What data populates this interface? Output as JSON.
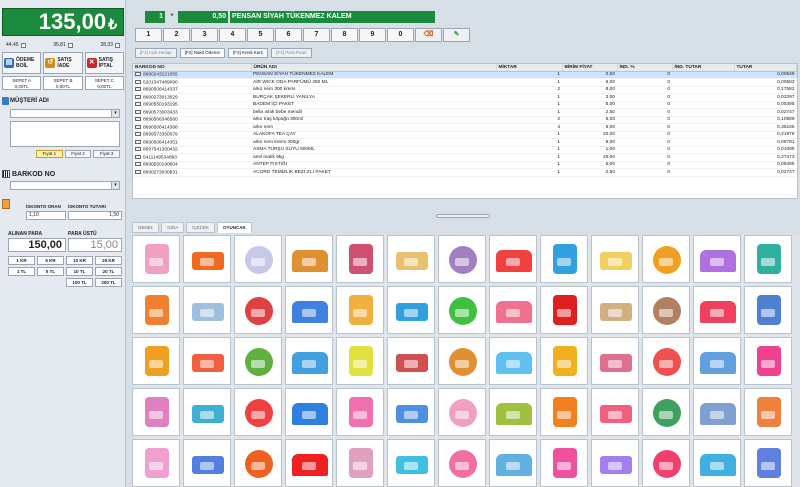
{
  "left_panel": {
    "total_amount": "135,00",
    "currency": "₺",
    "subtotals": [
      "44,45",
      "35,81",
      "28,33"
    ],
    "action_buttons": [
      {
        "label": "ÖDEME BOİL",
        "icon": "payment-icon",
        "color": "#2f6fbf"
      },
      {
        "label": "SATIŞ İADE",
        "icon": "return-icon",
        "color": "#d38b1a"
      },
      {
        "label": "SATIŞ İPTAL",
        "icon": "cancel-icon",
        "color": "#c82828"
      }
    ],
    "sepetler": [
      {
        "name": "SEPET A",
        "value": "0,00TL"
      },
      {
        "name": "SEPET B",
        "value": "0,00TL"
      },
      {
        "name": "SEPET C",
        "value": "0,00TL"
      }
    ],
    "musteri_label": "MÜŞTERİ ADI",
    "fiyatlar": [
      "Fiyat 1",
      "Fiyat 2",
      "Fiyat 3"
    ],
    "selected_fiyat": "Fiyat 1",
    "barkod_label": "BARKOD NO",
    "iskonto_oran_label": "İSKONTO ORAN",
    "iskonto_tutar_label": "İSKONTO TUTARI",
    "iskonto_oran": "1,10",
    "iskonto_tutar": "1,50",
    "alinan_label": "ALINAN PARA",
    "paraustu_label": "PARA ÜSTÜ",
    "alinan_para": "150,00",
    "para_ustu": "15,00",
    "para_buttons": [
      "1 KR",
      "5 KR",
      "10 KR",
      "25 KR",
      "1 TL",
      "5 TL",
      "10 TL",
      "20 TL",
      "",
      "",
      "100 TL",
      "200 TL"
    ]
  },
  "entry": {
    "quantity": "1",
    "multiplier": "*",
    "price": "0,50",
    "product_name": "PENSAN SİYAH TÜKENMEZ KALEM"
  },
  "numpad": [
    "1",
    "2",
    "3",
    "4",
    "5",
    "6",
    "7",
    "8",
    "9",
    "0"
  ],
  "payment_buttons": [
    {
      "label": "[F1] Açık Hesap",
      "enabled": false
    },
    {
      "label": "[F2] Nakit Ödeme",
      "enabled": true
    },
    {
      "label": "[F3] Kredi Kartı",
      "enabled": true
    },
    {
      "label": "[F4] Para Puan",
      "enabled": false
    }
  ],
  "table": {
    "columns": [
      "BARKOD NO",
      "ÜRÜN ADI",
      "MİKTAR",
      "BİRİM FİYAT",
      "İND. %",
      "İND. TUTAR",
      "TUTAR"
    ],
    "rows": [
      [
        "8690243221055",
        "PENSAN SİYAH TÜKENMEZ KALEM",
        "1",
        "0,50",
        "0",
        "",
        "0,00549"
      ],
      [
        "5201347489090",
        "AİR WICK ODA PARFÜMÜ 250 ML",
        "1",
        "6,00",
        "0",
        "",
        "0,00583"
      ],
      [
        "8690506414337",
        "arko nem 300 kremi",
        "2",
        "8,00",
        "0",
        "",
        "0,17582"
      ],
      [
        "8690273013029",
        "BURÇAK ŞEKERLİ YANILYA",
        "1",
        "3,00",
        "0",
        "",
        "0,03297"
      ],
      [
        "8690550193195",
        "BADEM İÇİ PAKET",
        "1",
        "5,00",
        "0",
        "",
        "0,05495"
      ],
      [
        "8690573003433",
        "bella ıslak bebe mendil",
        "1",
        "2,50",
        "0",
        "",
        "0,02747"
      ],
      [
        "8690506346560",
        "arko traş köpüğü 300ml",
        "2",
        "5,00",
        "0",
        "",
        "0,10989"
      ],
      [
        "8690506414388",
        "arko nem",
        "4",
        "8,00",
        "0",
        "",
        "0,35165"
      ],
      [
        "8699573350079",
        "ALAKOFA TEA ÇAY",
        "1",
        "20,00",
        "0",
        "",
        "0,21978"
      ],
      [
        "8690506414351",
        "arko nem kremi 300gr",
        "1",
        "8,00",
        "0",
        "",
        "0,08791"
      ],
      [
        "8697541300432",
        "ASMA TURŞU SUYU 500ML",
        "1",
        "1,00",
        "0",
        "",
        "0,01099"
      ],
      [
        "5411149534893",
        "ariel matik 6kg",
        "1",
        "25,00",
        "0",
        "",
        "0,27473"
      ],
      [
        "8690550190604",
        "ANTEP FISTIĞI",
        "1",
        "5,00",
        "0",
        "",
        "0,05495"
      ],
      [
        "8690273030831",
        "ACORD TEMİZLİK BEZİ 2'Lİ PAKET",
        "1",
        "2,50",
        "0",
        "",
        "0,02747"
      ]
    ]
  },
  "category_tabs": [
    "GENEL",
    "GIDA",
    "İÇECEK",
    "OYUNCAK"
  ],
  "active_category": "OYUNCAK",
  "product_colors": [
    [
      "#f0a0c0",
      "#f06a20",
      "#c8c8e8",
      "#e09030",
      "#d05070",
      "#e8c070",
      "#a080c0",
      "#f04040",
      "#30a0e0",
      "#f0d060",
      "#f0a020",
      "#b070e0",
      "#30b0a0"
    ],
    [
      "#f08030",
      "#a0c0e0",
      "#e04040",
      "#4080e0",
      "#f0b040",
      "#30a0e0",
      "#40c040",
      "#f07090",
      "#e02020",
      "#d0b080",
      "#b08060",
      "#f04060",
      "#5080d0"
    ],
    [
      "#f0a020",
      "#f06040",
      "#60b040",
      "#40a0e0",
      "#e0e040",
      "#d05050",
      "#e09030",
      "#60c0f0",
      "#f0b020",
      "#e07090",
      "#f05050",
      "#60a0e0",
      "#f04090"
    ],
    [
      "#e080c0",
      "#40b0d0",
      "#f04040",
      "#3080e0",
      "#f070b0",
      "#5090e0",
      "#f0a0c0",
      "#a0c040",
      "#f08020",
      "#f06080",
      "#40a060",
      "#80a0d0",
      "#f08040"
    ],
    [
      "#f0a0d0",
      "#5080e0",
      "#f06020",
      "#f02020",
      "#e0a0c0",
      "#40c0e0",
      "#f070a0",
      "#60b0e0",
      "#f050a0",
      "#a080f0",
      "#f04070",
      "#40b0e0",
      "#6080e0"
    ]
  ]
}
